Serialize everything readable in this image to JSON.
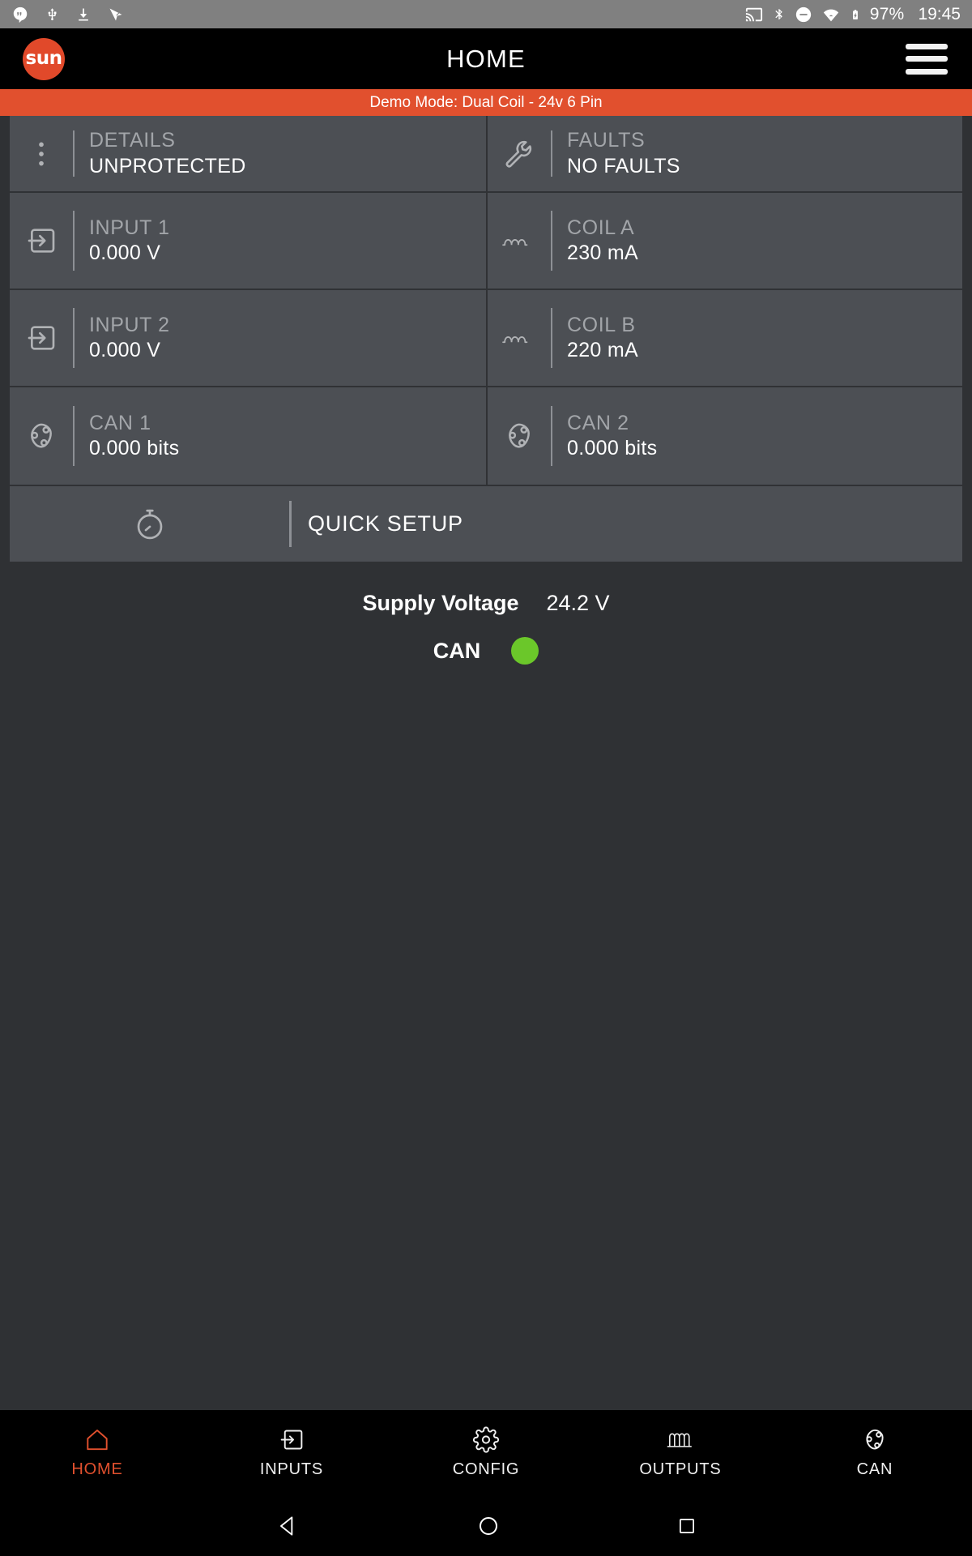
{
  "statusbar": {
    "left_icons": [
      "hangouts-icon",
      "usb-icon",
      "download-icon",
      "vpn-check-icon"
    ],
    "right_icons": [
      "cast-icon",
      "bluetooth-icon",
      "do-not-disturb-icon",
      "wifi-icon",
      "battery-charging-icon"
    ],
    "battery_percent": "97%",
    "time": "19:45"
  },
  "appbar": {
    "logo_text": "sun",
    "title": "HOME",
    "menu_icon": "hamburger-menu-icon"
  },
  "banner": {
    "text": "Demo Mode: Dual Coil - 24v 6 Pin",
    "color": "#e1502e"
  },
  "cards": [
    {
      "icon": "more-vert-icon",
      "label": "DETAILS",
      "value": "UNPROTECTED"
    },
    {
      "icon": "wrench-icon",
      "label": "FAULTS",
      "value": "NO FAULTS"
    },
    {
      "icon": "input-arrow-icon",
      "label": "INPUT 1",
      "value": "0.000 V"
    },
    {
      "icon": "coil-icon",
      "label": "COIL A",
      "value": "230 mA"
    },
    {
      "icon": "input-arrow-icon",
      "label": "INPUT 2",
      "value": "0.000 V"
    },
    {
      "icon": "coil-icon",
      "label": "COIL B",
      "value": "220 mA"
    },
    {
      "icon": "can-network-icon",
      "label": "CAN 1",
      "value": "0.000 bits"
    },
    {
      "icon": "can-network-icon",
      "label": "CAN 2",
      "value": "0.000 bits"
    }
  ],
  "quick_setup": {
    "icon": "stopwatch-icon",
    "label": "QUICK SETUP"
  },
  "summary": {
    "supply_voltage_label": "Supply Voltage",
    "supply_voltage_value": "24.2 V",
    "can_label": "CAN",
    "can_status_color": "#6bc72a"
  },
  "bottom_nav": {
    "active": "HOME",
    "items": [
      {
        "label": "HOME",
        "icon": "home-icon"
      },
      {
        "label": "INPUTS",
        "icon": "input-arrow-icon"
      },
      {
        "label": "CONFIG",
        "icon": "gear-icon"
      },
      {
        "label": "OUTPUTS",
        "icon": "solenoid-waveform-icon"
      },
      {
        "label": "CAN",
        "icon": "can-network-icon"
      }
    ]
  },
  "android_nav": {
    "back": "back-triangle-icon",
    "home": "home-circle-icon",
    "recents": "recents-square-icon"
  }
}
